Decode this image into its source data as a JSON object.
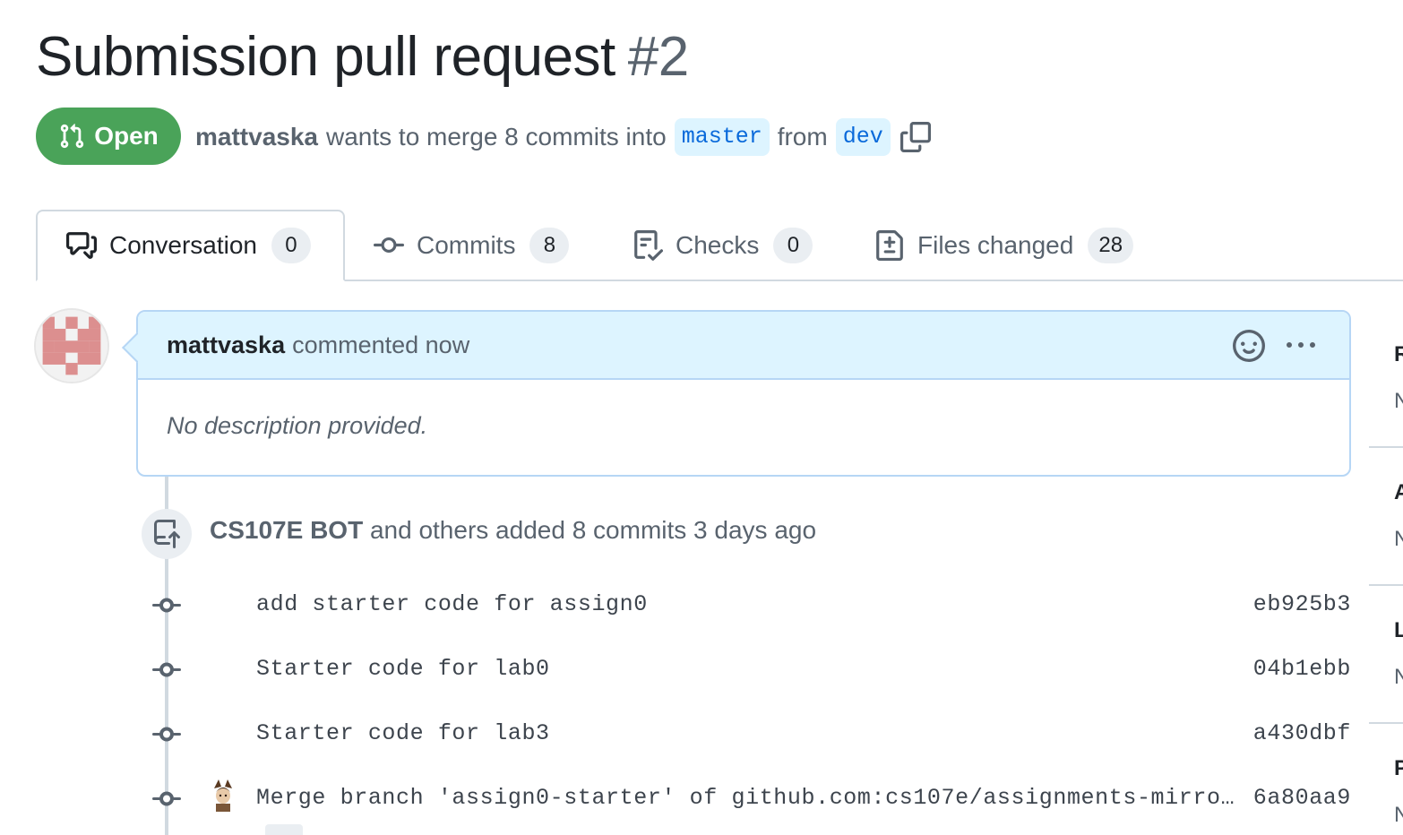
{
  "pr": {
    "title": "Submission pull request",
    "number": "#2",
    "state": "Open",
    "author": "mattvaska",
    "merge_text": "wants to merge 8 commits into",
    "base_branch": "master",
    "from_text": "from",
    "head_branch": "dev"
  },
  "tabs": [
    {
      "label": "Conversation",
      "count": "0",
      "icon": "comment-discussion-icon"
    },
    {
      "label": "Commits",
      "count": "8",
      "icon": "git-commit-icon"
    },
    {
      "label": "Checks",
      "count": "0",
      "icon": "checklist-icon"
    },
    {
      "label": "Files changed",
      "count": "28",
      "icon": "file-diff-icon"
    }
  ],
  "comment": {
    "author": "mattvaska",
    "action": "commented now",
    "body": "No description provided."
  },
  "push_event": {
    "actor": "CS107E BOT",
    "text": "and others added 8 commits 3 days ago"
  },
  "commits": [
    {
      "message": "add starter code for assign0",
      "sha": "eb925b3"
    },
    {
      "message": "Starter code for lab0",
      "sha": "04b1ebb"
    },
    {
      "message": "Starter code for lab3",
      "sha": "a430dbf"
    },
    {
      "message": "Merge branch 'assign0-starter' of github.com:cs107e/assignments-mirro…",
      "sha": "6a80aa9"
    }
  ],
  "sidebar_fragments": [
    "R",
    "N",
    "A",
    "N",
    "L",
    "N",
    "P",
    "N"
  ],
  "colors": {
    "open_green": "#4aa359",
    "link_blue": "#0969da",
    "branch_bg": "#ddf4ff",
    "comment_header_bg": "#ddf4ff",
    "comment_border": "#b6d6f5"
  }
}
